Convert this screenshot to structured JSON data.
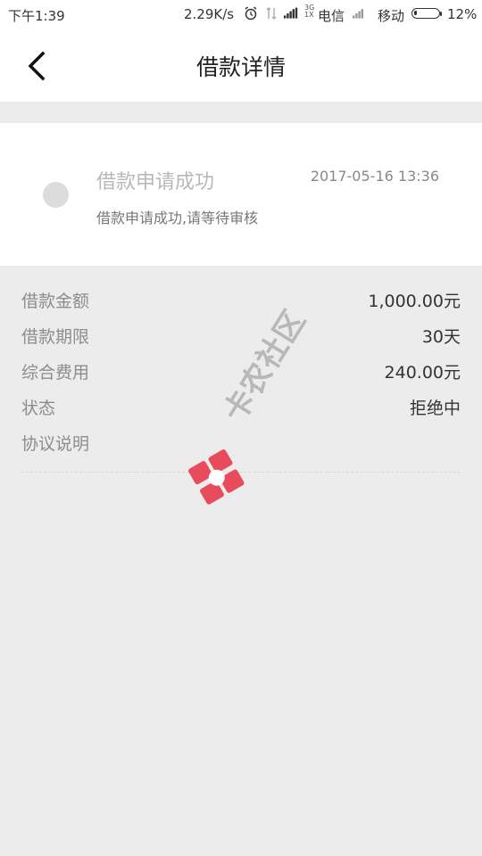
{
  "status_bar": {
    "time": "下午1:39",
    "speed": "2.29K/s",
    "network_type": "3G\n1X",
    "carrier1": "电信",
    "carrier2": "移动",
    "battery": "12%",
    "icons": [
      "alarm-icon",
      "signal-icon",
      "battery-icon"
    ]
  },
  "header": {
    "title": "借款详情",
    "back_icon": "chevron-left-icon"
  },
  "progress": {
    "title": "借款申请成功",
    "time": "2017-05-16 13:36",
    "description": "借款申请成功,请等待审核"
  },
  "details": [
    {
      "label": "借款金额",
      "value": "1,000.00元"
    },
    {
      "label": "借款期限",
      "value": "30天"
    },
    {
      "label": "综合费用",
      "value": "240.00元"
    },
    {
      "label": "状态",
      "value": "拒绝中"
    },
    {
      "label": "协议说明",
      "value": ""
    }
  ],
  "watermark": {
    "text": "卡农社区",
    "logo_color": "#e84c5c"
  }
}
